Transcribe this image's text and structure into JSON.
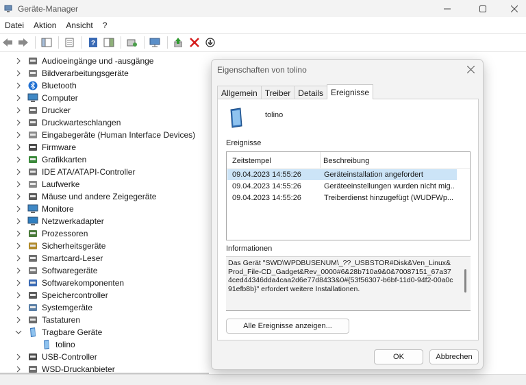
{
  "window": {
    "title": "Geräte-Manager"
  },
  "menu": [
    "Datei",
    "Aktion",
    "Ansicht",
    "?"
  ],
  "tree": [
    {
      "label": "Audioeingänge und -ausgänge",
      "icon": "speaker-icon"
    },
    {
      "label": "Bildverarbeitungsgeräte",
      "icon": "camera-icon"
    },
    {
      "label": "Bluetooth",
      "icon": "bluetooth-icon"
    },
    {
      "label": "Computer",
      "icon": "computer-icon"
    },
    {
      "label": "Drucker",
      "icon": "printer-icon"
    },
    {
      "label": "Druckwarteschlangen",
      "icon": "print-queue-icon"
    },
    {
      "label": "Eingabegeräte (Human Interface Devices)",
      "icon": "hid-icon"
    },
    {
      "label": "Firmware",
      "icon": "firmware-icon"
    },
    {
      "label": "Grafikkarten",
      "icon": "display-adapter-icon"
    },
    {
      "label": "IDE ATA/ATAPI-Controller",
      "icon": "ide-controller-icon"
    },
    {
      "label": "Laufwerke",
      "icon": "disk-drive-icon"
    },
    {
      "label": "Mäuse und andere Zeigegeräte",
      "icon": "mouse-icon"
    },
    {
      "label": "Monitore",
      "icon": "monitor-icon"
    },
    {
      "label": "Netzwerkadapter",
      "icon": "network-adapter-icon"
    },
    {
      "label": "Prozessoren",
      "icon": "processor-icon"
    },
    {
      "label": "Sicherheitsgeräte",
      "icon": "security-device-icon"
    },
    {
      "label": "Smartcard-Leser",
      "icon": "smartcard-reader-icon"
    },
    {
      "label": "Softwaregeräte",
      "icon": "software-device-icon"
    },
    {
      "label": "Softwarekomponenten",
      "icon": "software-component-icon"
    },
    {
      "label": "Speichercontroller",
      "icon": "storage-controller-icon"
    },
    {
      "label": "Systemgeräte",
      "icon": "system-device-icon"
    },
    {
      "label": "Tastaturen",
      "icon": "keyboard-icon"
    },
    {
      "label": "Tragbare Geräte",
      "icon": "portable-device-icon",
      "expanded": true
    },
    {
      "label": "tolino",
      "icon": "portable-device-icon",
      "child": true
    },
    {
      "label": "USB-Controller",
      "icon": "usb-icon"
    },
    {
      "label": "WSD-Druckanbieter",
      "icon": "wsd-printer-icon"
    }
  ],
  "dialog": {
    "title": "Eigenschaften von tolino",
    "tabs": [
      "Allgemein",
      "Treiber",
      "Details",
      "Ereignisse"
    ],
    "active_tab": "Ereignisse",
    "device_name": "tolino",
    "events_label": "Ereignisse",
    "columns": [
      "Zeitstempel",
      "Beschreibung"
    ],
    "events": [
      {
        "time": "09.04.2023 14:55:26",
        "desc": "Geräteinstallation angefordert",
        "selected": true
      },
      {
        "time": "09.04.2023 14:55:26",
        "desc": "Geräteeinstellungen wurden nicht mig..."
      },
      {
        "time": "09.04.2023 14:55:26",
        "desc": "Treiberdienst hinzugefügt (WUDFWp..."
      }
    ],
    "info_label": "Informationen",
    "info_text": "Das Gerät \"SWD\\WPDBUSENUM\\_??_USBSTOR#Disk&Ven_Linux&Prod_File-CD_Gadget&Rev_0000#6&28b710a9&0&70087151_67a374ced44346dda4caa2d6e77d8433&0#{53f56307-b6bf-11d0-94f2-00a0c91efb8b}\" erfordert weitere Installationen.",
    "show_all_button": "Alle Ereignisse anzeigen...",
    "ok_button": "OK",
    "cancel_button": "Abbrechen"
  },
  "colors": {
    "selection": "#cce4f7",
    "accent": "#0067c0"
  }
}
